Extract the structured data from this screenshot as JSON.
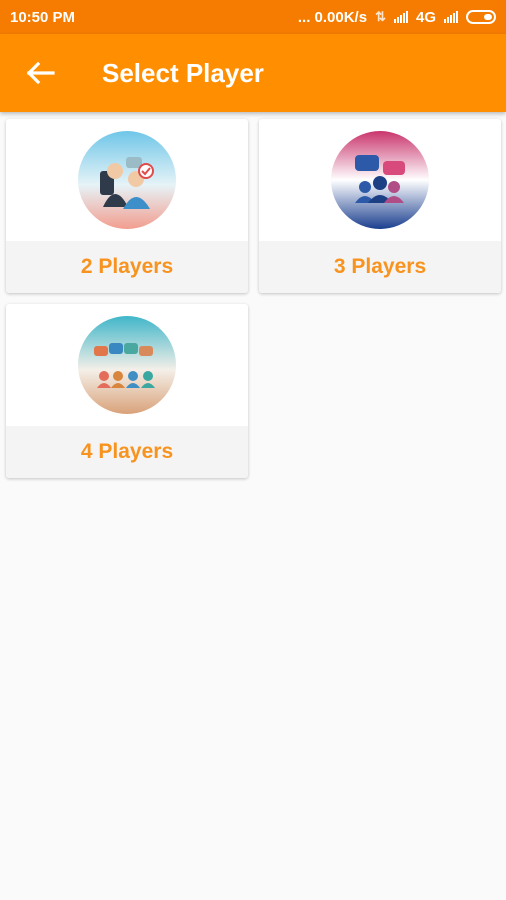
{
  "status_bar": {
    "time": "10:50 PM",
    "speed": "... 0.00K/s",
    "network": "4G"
  },
  "header": {
    "title": "Select Player",
    "back_icon": "arrow-back-icon"
  },
  "colors": {
    "status_bar": "#f57c00",
    "app_bar": "#ff8f00",
    "accent_text": "#f7931e"
  },
  "options": [
    {
      "label": "2 Players",
      "icon": "two-players-illustration"
    },
    {
      "label": "3 Players",
      "icon": "three-players-illustration"
    },
    {
      "label": "4 Players",
      "icon": "four-players-illustration"
    }
  ]
}
